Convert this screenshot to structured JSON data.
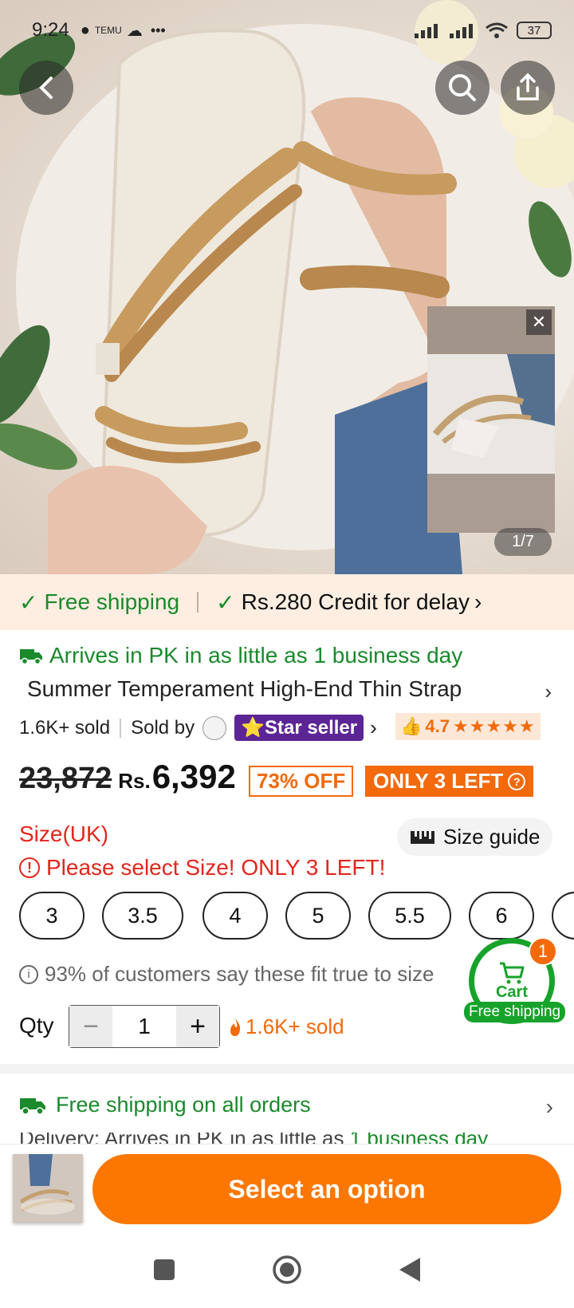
{
  "status_bar": {
    "time": "9:24",
    "app_badge": "TEMU",
    "dots": "•••",
    "battery": "37"
  },
  "hero": {
    "counter": "1/7",
    "close_symbol": "✕"
  },
  "banner": {
    "free_shipping": "Free shipping",
    "credit": "Rs.280 Credit for delay",
    "chevron": "›"
  },
  "arrives": "Arrives in PK in as little as 1 business day",
  "product": {
    "title": "Summer Temperament High-End Thin Strap",
    "sold": "1.6K+ sold",
    "sold_by": "Sold by",
    "star_seller": "Star seller",
    "rating": "4.7",
    "stars": "★★★★★"
  },
  "price": {
    "old": "23,872",
    "currency": "Rs.",
    "current": "6,392",
    "discount": "73% OFF",
    "stock": "ONLY 3 LEFT"
  },
  "size": {
    "label": "Size(UK)",
    "guide": "Size guide",
    "warning": "Please select Size! ONLY 3 LEFT!",
    "options": [
      "3",
      "3.5",
      "4",
      "5",
      "5.5",
      "6"
    ],
    "fit_note": "93% of customers say these fit true to size"
  },
  "quantity": {
    "label": "Qty",
    "minus": "−",
    "value": "1",
    "plus": "+",
    "sold": "1.6K+ sold"
  },
  "cart": {
    "label": "Cart",
    "count": "1",
    "free": "Free shipping"
  },
  "shipping": {
    "all_orders": "Free shipping on all orders",
    "delivery_prefix": "Delivery: Arrives in PK in as little as",
    "delivery_highlight": "1 business day"
  },
  "cta": {
    "select_option": "Select an option"
  },
  "colors": {
    "accent": "#fb7701",
    "green": "#1a8a2c",
    "red": "#e3261c",
    "star_seller": "#5c2596"
  }
}
